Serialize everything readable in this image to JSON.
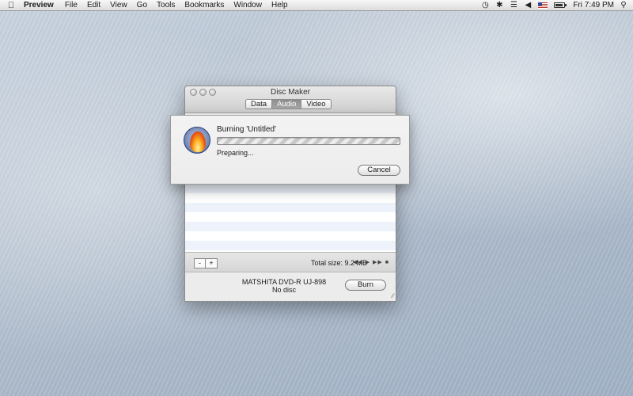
{
  "menubar": {
    "apple_icon": "apple-icon",
    "app_name": "Preview",
    "items": [
      "File",
      "Edit",
      "View",
      "Go",
      "Tools",
      "Bookmarks",
      "Window",
      "Help"
    ],
    "status_icons": [
      "time-machine-icon",
      "bluetooth-icon",
      "wifi-icon",
      "volume-icon",
      "flag-us-icon",
      "battery-icon",
      "spotlight-icon"
    ],
    "clock": "Fri 7:49 PM"
  },
  "window": {
    "title": "Disc Maker",
    "tabs": [
      {
        "label": "Data",
        "active": false
      },
      {
        "label": "Audio",
        "active": true
      },
      {
        "label": "Video",
        "active": false
      }
    ],
    "toolbar": {
      "remove_label": "-",
      "add_label": "+",
      "total_size": "Total size: 9.2 MB",
      "transport_icons": [
        "rewind-icon",
        "play-icon",
        "fast-forward-icon",
        "stop-icon"
      ]
    },
    "drive": {
      "name": "MATSHITA DVD-R UJ-898",
      "status": "No disc"
    },
    "burn_label": "Burn"
  },
  "sheet": {
    "title": "Burning 'Untitled'",
    "status": "Preparing...",
    "progress": 0,
    "cancel_label": "Cancel"
  },
  "colors": {
    "tab_active": "#9a9a9a",
    "row_stripe": "#edf2fb",
    "icon_disc": "#6f84b5",
    "flame": "#e24a12"
  }
}
